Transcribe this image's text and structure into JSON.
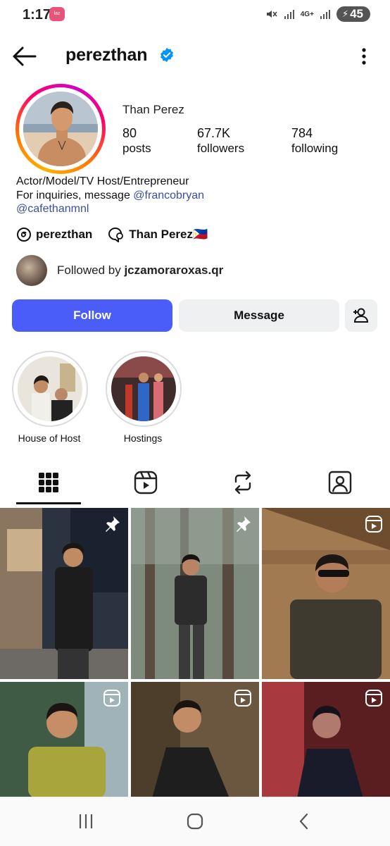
{
  "status_bar": {
    "time": "1:17",
    "network": "4G+",
    "battery": "45",
    "notification_app": "lazada-icon"
  },
  "header": {
    "username": "perezthan",
    "verified": true,
    "back_icon": "arrow-left-icon",
    "menu_icon": "more-vertical-icon"
  },
  "profile": {
    "full_name": "Than Perez",
    "stats": [
      {
        "value": "80",
        "label": "posts"
      },
      {
        "value": "67.7K",
        "label": "followers"
      },
      {
        "value": "784",
        "label": "following"
      }
    ],
    "bio_line1": "Actor/Model/TV Host/Entrepreneur",
    "bio_line2_prefix": "For inquiries, message ",
    "bio_line2_mention": "@francobryan",
    "bio_line3_mention": "@cafethanmnl",
    "threads_handle": "perezthan",
    "messenger_name": "Than Perez🇵🇭",
    "followed_by_prefix": "Followed by ",
    "followed_by_user": "jczamoraroxas.qr"
  },
  "actions": {
    "follow": "Follow",
    "message": "Message",
    "add_user_icon": "add-user-icon"
  },
  "highlights": [
    {
      "label": "House of Host"
    },
    {
      "label": "Hostings"
    }
  ],
  "tabs": [
    {
      "name": "grid-icon",
      "active": true
    },
    {
      "name": "reels-icon",
      "active": false
    },
    {
      "name": "reposts-icon",
      "active": false
    },
    {
      "name": "tagged-icon",
      "active": false
    }
  ],
  "posts": [
    {
      "badge": "pin-icon"
    },
    {
      "badge": "pin-icon"
    },
    {
      "badge": "reel-icon"
    },
    {
      "badge": "reel-icon"
    },
    {
      "badge": "reel-icon"
    },
    {
      "badge": "reel-icon"
    }
  ],
  "colors": {
    "accent": "#4a5df9",
    "link": "#3a4fa0",
    "verified": "#0095f6"
  }
}
